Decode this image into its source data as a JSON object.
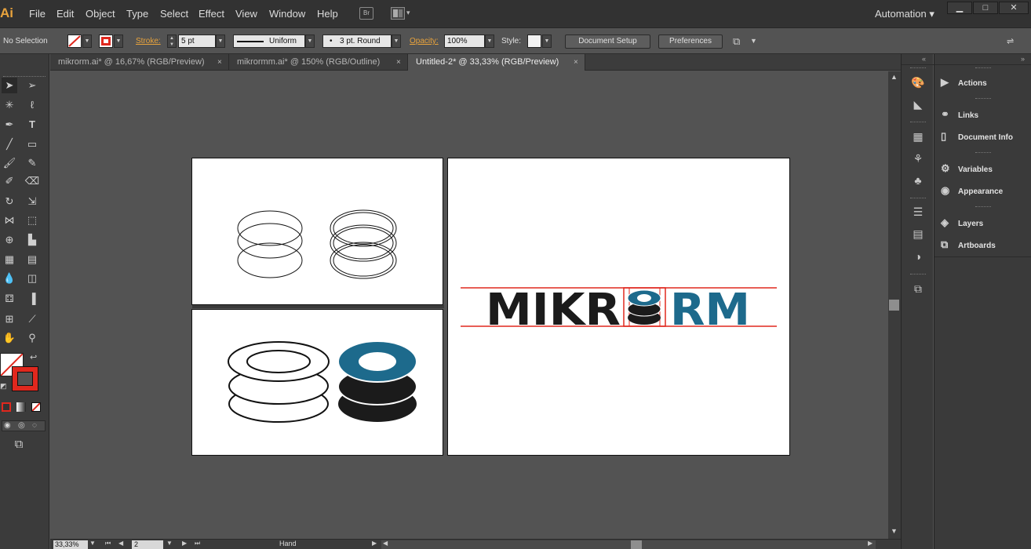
{
  "app": {
    "logo": "Ai"
  },
  "menu": [
    "File",
    "Edit",
    "Object",
    "Type",
    "Select",
    "Effect",
    "View",
    "Window",
    "Help"
  ],
  "bridge_label": "Br",
  "workspace": "Automation",
  "window_controls": {
    "minimize": "▁",
    "maximize": "□",
    "close": "✕"
  },
  "control": {
    "selection": "No Selection",
    "stroke_label": "Stroke:",
    "stroke_value": "5 pt",
    "profile": "Uniform",
    "brush": "3 pt. Round",
    "opacity_label": "Opacity:",
    "opacity_value": "100%",
    "style_label": "Style:",
    "document_setup": "Document Setup",
    "preferences": "Preferences"
  },
  "tabs": [
    {
      "label": "mikrorm.ai* @ 16,67% (RGB/Preview)",
      "close": "×"
    },
    {
      "label": "mikrormm.ai* @ 150% (RGB/Outline)",
      "close": "×"
    },
    {
      "label": "Untitled-2* @ 33,33% (RGB/Preview)",
      "close": "×"
    }
  ],
  "logo_text": {
    "left": "MIKR",
    "right": "RM"
  },
  "colors": {
    "brand_dark": "#1b1b1b",
    "brand_teal": "#1d6a8c",
    "guide_red": "#e0281e",
    "accent_orange": "#e8a33d"
  },
  "status": {
    "zoom": "33,33%",
    "artboard": "2",
    "tool": "Hand"
  },
  "panels": [
    {
      "label": "Actions",
      "icon": "play-icon"
    },
    {
      "label": "Links",
      "icon": "link-icon"
    },
    {
      "label": "Document Info",
      "icon": "document-icon"
    },
    {
      "label": "Variables",
      "icon": "variables-icon"
    },
    {
      "label": "Appearance",
      "icon": "appearance-icon"
    },
    {
      "label": "Layers",
      "icon": "layers-icon"
    },
    {
      "label": "Artboards",
      "icon": "artboards-icon"
    }
  ]
}
